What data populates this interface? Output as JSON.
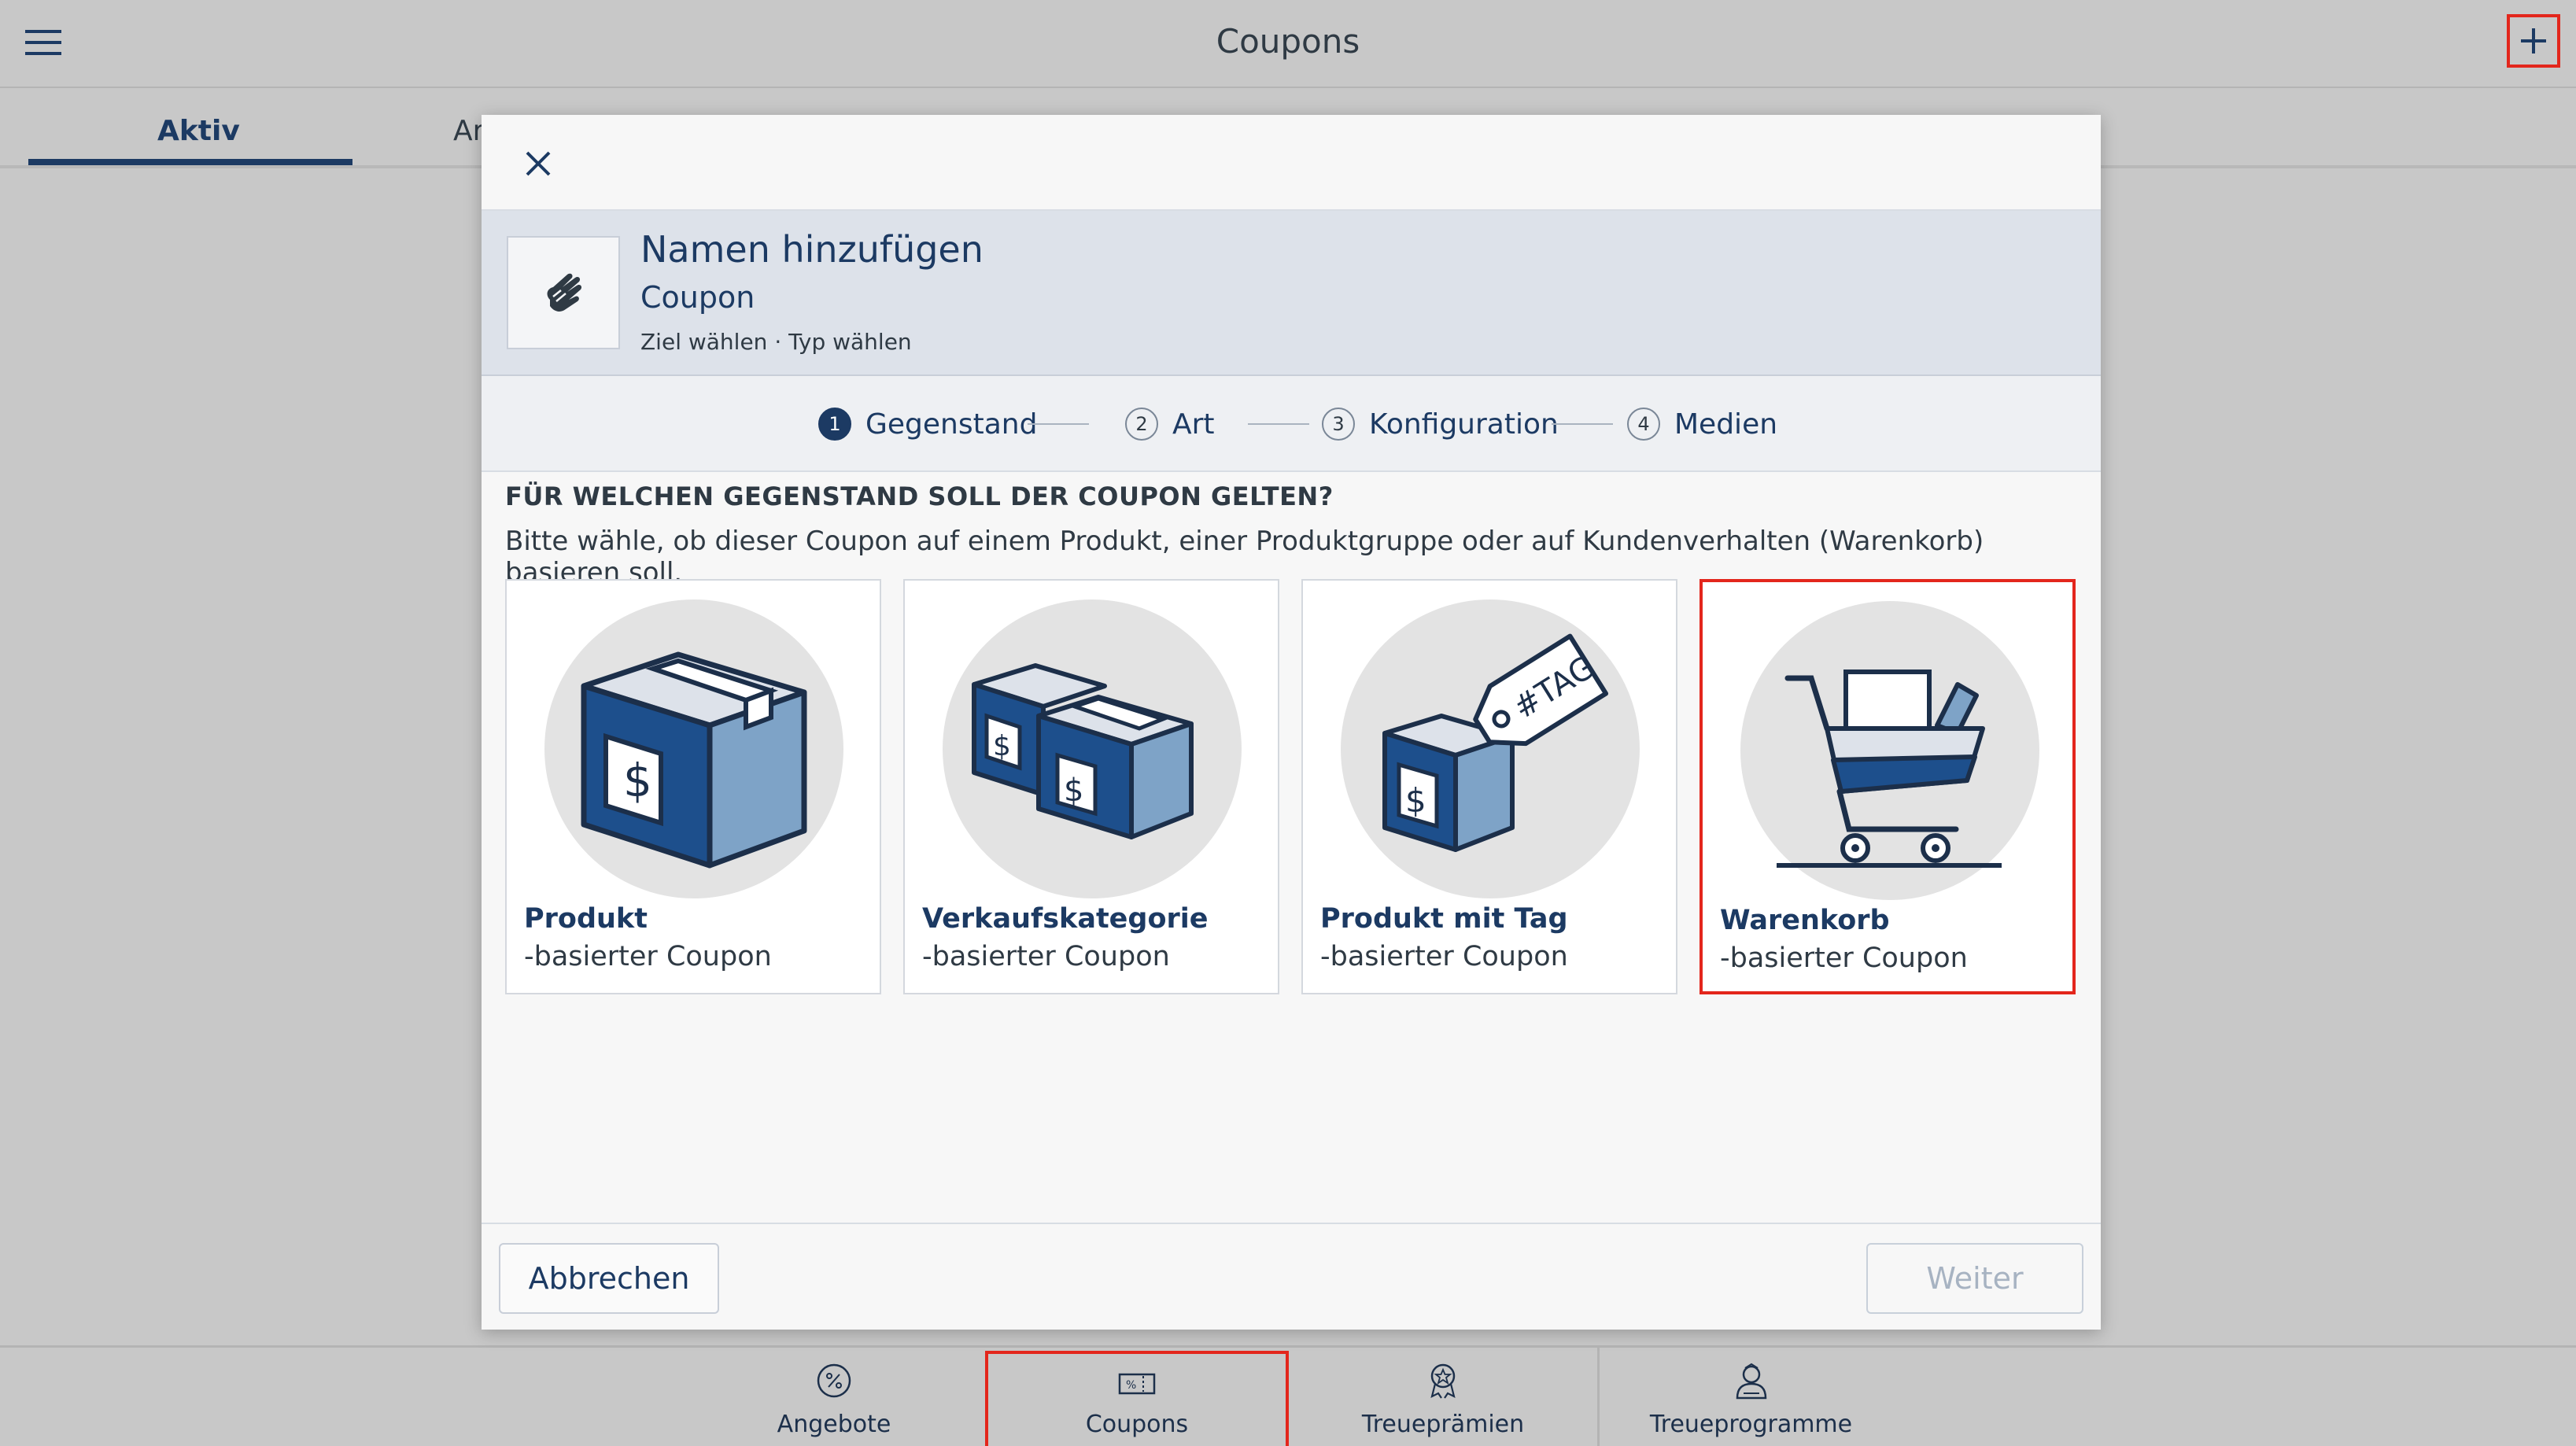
{
  "app": {
    "title": "Coupons",
    "menu_icon": "hamburger-menu-icon",
    "add_icon": "plus-icon"
  },
  "tabs": [
    {
      "label": "Aktiv",
      "active": true
    },
    {
      "label": "Ar",
      "active": false
    }
  ],
  "modal": {
    "close_icon": "close-icon",
    "header": {
      "icon": "hand-gesture-icon",
      "title": "Namen hinzufügen",
      "subtitle": "Coupon",
      "steps_text": "Ziel wählen · Typ wählen"
    },
    "stepper": [
      {
        "num": "1",
        "label": "Gegenstand",
        "active": true
      },
      {
        "num": "2",
        "label": "Art",
        "active": false
      },
      {
        "num": "3",
        "label": "Konfiguration",
        "active": false
      },
      {
        "num": "4",
        "label": "Medien",
        "active": false
      }
    ],
    "question": {
      "title": "FÜR WELCHEN GEGENSTAND SOLL DER COUPON GELTEN?",
      "description": "Bitte wähle, ob dieser Coupon auf einem Produkt, einer Produktgruppe oder auf Kundenverhalten (Warenkorb) basieren soll."
    },
    "options": [
      {
        "title": "Produkt",
        "subtitle": "-basierter Coupon",
        "icon": "product-box-icon",
        "selected": false
      },
      {
        "title": "Verkaufskategorie",
        "subtitle": "-basierter Coupon",
        "icon": "category-boxes-icon",
        "selected": false
      },
      {
        "title": "Produkt mit Tag",
        "subtitle": "-basierter Coupon",
        "icon": "tagged-box-icon",
        "selected": false
      },
      {
        "title": "Warenkorb",
        "subtitle": "-basierter Coupon",
        "icon": "shopping-cart-icon",
        "selected": true
      }
    ],
    "footer": {
      "cancel_label": "Abbrechen",
      "next_label": "Weiter"
    }
  },
  "bottom_nav": [
    {
      "label": "Angebote",
      "icon": "percent-badge-icon"
    },
    {
      "label": "Coupons",
      "icon": "coupon-ticket-icon",
      "active": true
    },
    {
      "label": "Treueprämien",
      "icon": "award-ribbon-icon"
    },
    {
      "label": "Treueprogramme",
      "icon": "loyalty-person-icon"
    }
  ],
  "colors": {
    "accent": "#1c3a63",
    "highlight": "#e3261c",
    "overlay": "#c8c8c8"
  }
}
